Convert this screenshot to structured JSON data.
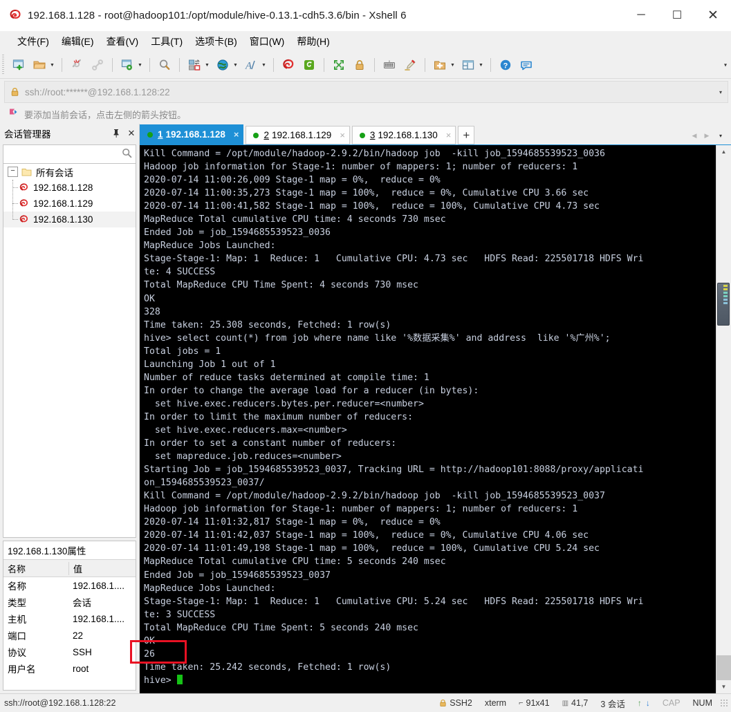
{
  "window": {
    "title": "192.168.1.128 - root@hadoop101:/opt/module/hive-0.13.1-cdh5.3.6/bin - Xshell 6",
    "app_icon": "xshell-icon",
    "minimize_label": "─",
    "maximize_label": "☐",
    "close_label": "✕"
  },
  "menubar": {
    "items": [
      {
        "label": "文件(F)",
        "name": "menu-file"
      },
      {
        "label": "编辑(E)",
        "name": "menu-edit"
      },
      {
        "label": "查看(V)",
        "name": "menu-view"
      },
      {
        "label": "工具(T)",
        "name": "menu-tools"
      },
      {
        "label": "选项卡(B)",
        "name": "menu-tab"
      },
      {
        "label": "窗口(W)",
        "name": "menu-window"
      },
      {
        "label": "帮助(H)",
        "name": "menu-help"
      }
    ]
  },
  "toolbar": {
    "overflow_caret": "▾",
    "icons": [
      "new-session-icon",
      "open-folder-icon",
      "disconnect-icon",
      "reconnect-icon",
      "session-properties-icon",
      "find-icon",
      "file-transfer-icon",
      "globe-icon",
      "font-icon",
      "xshell-icon",
      "xftp-icon",
      "fullscreen-icon",
      "lock-icon",
      "keyboard-icon",
      "highlight-icon",
      "new-folder-icon",
      "layout-icon",
      "help-icon",
      "feedback-icon"
    ]
  },
  "addressbar": {
    "lock_icon": "lock-icon",
    "value": "ssh://root:******@192.168.1.128:22",
    "caret": "▾"
  },
  "notice": {
    "icon": "arrow-flag-icon",
    "text": "要添加当前会话，点击左侧的箭头按钮。"
  },
  "sidebar": {
    "title": "会话管理器",
    "pin_icon": "pin-icon",
    "close_icon": "close-icon",
    "search_icon": "search-icon",
    "search_value": "",
    "tree": {
      "root_label": "所有会话",
      "expander": "−",
      "items": [
        {
          "label": "192.168.1.128",
          "selected": false
        },
        {
          "label": "192.168.1.129",
          "selected": false
        },
        {
          "label": "192.168.1.130",
          "selected": true
        }
      ]
    },
    "properties": {
      "title": "192.168.1.130属性",
      "columns": [
        "名称",
        "值"
      ],
      "rows": [
        {
          "name": "名称",
          "value": "192.168.1...."
        },
        {
          "name": "类型",
          "value": "会话"
        },
        {
          "name": "主机",
          "value": "192.168.1...."
        },
        {
          "name": "端口",
          "value": "22"
        },
        {
          "name": "协议",
          "value": "SSH"
        },
        {
          "name": "用户名",
          "value": "root"
        }
      ]
    }
  },
  "tabs": {
    "items": [
      {
        "num": "1",
        "label": "192.168.1.128",
        "active": true,
        "close": "×",
        "status_color": "#16a016"
      },
      {
        "num": "2",
        "label": "192.168.1.129",
        "active": false,
        "close": "×",
        "status_color": "#16a016"
      },
      {
        "num": "3",
        "label": "192.168.1.130",
        "active": false,
        "close": "×",
        "status_color": "#16a016"
      }
    ],
    "add_label": "+",
    "nav_prev": "◀",
    "nav_next": "▶",
    "nav_dropdown": "▾"
  },
  "terminal": {
    "prompt": "hive> ",
    "cursor": "block-cursor",
    "text": "Kill Command = /opt/module/hadoop-2.9.2/bin/hadoop job  -kill job_1594685539523_0036\nHadoop job information for Stage-1: number of mappers: 1; number of reducers: 1\n2020-07-14 11:00:26,009 Stage-1 map = 0%,  reduce = 0%\n2020-07-14 11:00:35,273 Stage-1 map = 100%,  reduce = 0%, Cumulative CPU 3.66 sec\n2020-07-14 11:00:41,582 Stage-1 map = 100%,  reduce = 100%, Cumulative CPU 4.73 sec\nMapReduce Total cumulative CPU time: 4 seconds 730 msec\nEnded Job = job_1594685539523_0036\nMapReduce Jobs Launched:\nStage-Stage-1: Map: 1  Reduce: 1   Cumulative CPU: 4.73 sec   HDFS Read: 225501718 HDFS Wri\nte: 4 SUCCESS\nTotal MapReduce CPU Time Spent: 4 seconds 730 msec\nOK\n328\nTime taken: 25.308 seconds, Fetched: 1 row(s)\nhive> select count(*) from job where name like '%数据采集%' and address  like '%广州%';\nTotal jobs = 1\nLaunching Job 1 out of 1\nNumber of reduce tasks determined at compile time: 1\nIn order to change the average load for a reducer (in bytes):\n  set hive.exec.reducers.bytes.per.reducer=<number>\nIn order to limit the maximum number of reducers:\n  set hive.exec.reducers.max=<number>\nIn order to set a constant number of reducers:\n  set mapreduce.job.reduces=<number>\nStarting Job = job_1594685539523_0037, Tracking URL = http://hadoop101:8088/proxy/applicati\non_1594685539523_0037/\nKill Command = /opt/module/hadoop-2.9.2/bin/hadoop job  -kill job_1594685539523_0037\nHadoop job information for Stage-1: number of mappers: 1; number of reducers: 1\n2020-07-14 11:01:32,817 Stage-1 map = 0%,  reduce = 0%\n2020-07-14 11:01:42,037 Stage-1 map = 100%,  reduce = 0%, Cumulative CPU 4.06 sec\n2020-07-14 11:01:49,198 Stage-1 map = 100%,  reduce = 100%, Cumulative CPU 5.24 sec\nMapReduce Total cumulative CPU time: 5 seconds 240 msec\nEnded Job = job_1594685539523_0037\nMapReduce Jobs Launched:\nStage-Stage-1: Map: 1  Reduce: 1   Cumulative CPU: 5.24 sec   HDFS Read: 225501718 HDFS Wri\nte: 3 SUCCESS\nTotal MapReduce CPU Time Spent: 5 seconds 240 msec\nOK\n26\nTime taken: 25.242 seconds, Fetched: 1 row(s)\n",
    "highlight": {
      "value": "26",
      "border_color": "#e81123"
    },
    "scroll_up": "▲",
    "scroll_down": "▼"
  },
  "statusbar": {
    "connection": "ssh://root@192.168.1.128:22",
    "lock_icon": "lock-icon",
    "protocol": "SSH2",
    "terminal_type": "xterm",
    "size_icon": "resize-icon",
    "size": "91x41",
    "cursor_icon": "cursor-pos-icon",
    "cursor_pos": "41,7",
    "sessions": "3 会话",
    "arrow_up": "↑",
    "arrow_down": "↓",
    "cap": "CAP",
    "num": "NUM"
  }
}
